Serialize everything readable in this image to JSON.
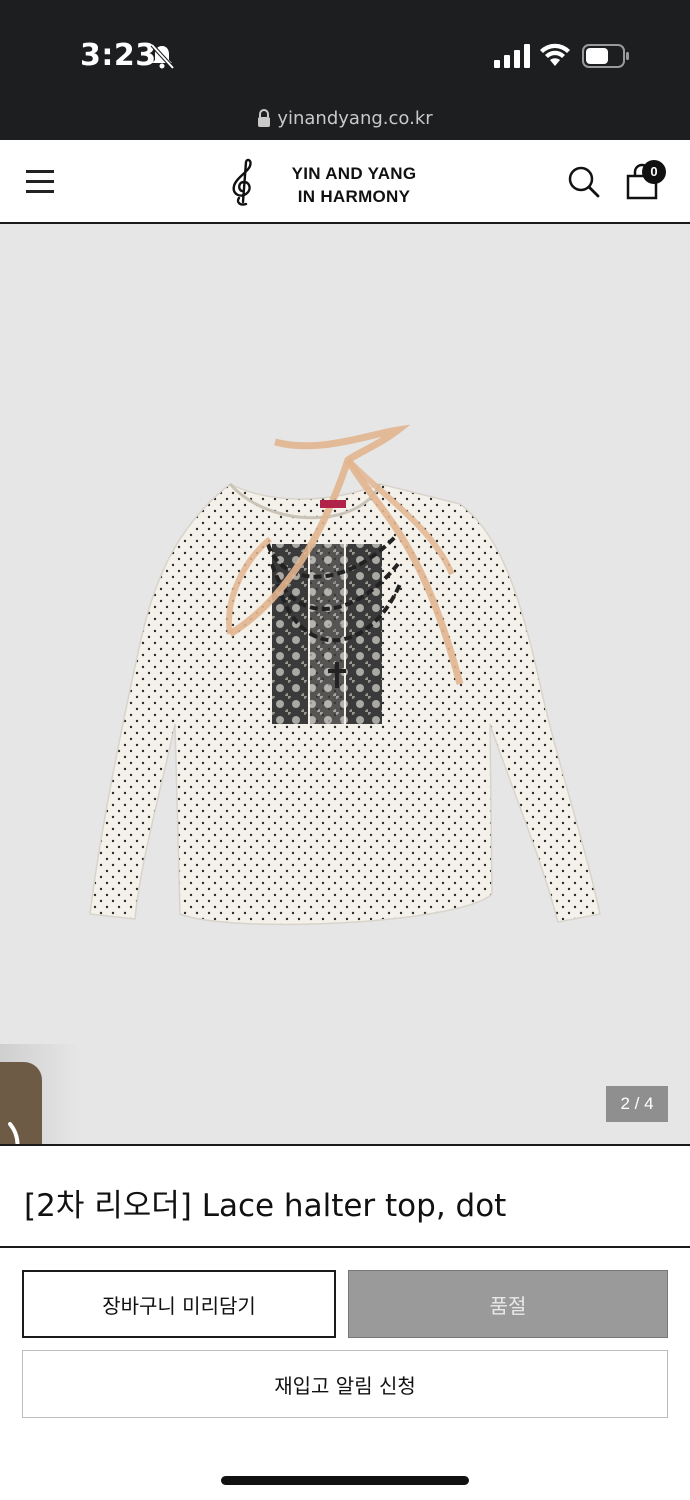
{
  "status_bar": {
    "time": "3:23"
  },
  "browser": {
    "url": "yinandyang.co.kr"
  },
  "header": {
    "logo_line1": "YIN AND YANG",
    "logo_line2": "IN HARMONY",
    "cart_count": "0",
    "icons": [
      "menu-icon",
      "treble-clef-logo",
      "search-icon",
      "shopping-bag-icon"
    ]
  },
  "gallery": {
    "counter": "2 / 4",
    "current_image": 2,
    "total_images": 4
  },
  "product": {
    "title": "[2차 리오더] Lace halter top, dot"
  },
  "actions": {
    "add_to_cart": "장바구니 미리담기",
    "sold_out": "품절",
    "restock_alert": "재입고 알림 신청"
  },
  "colors": {
    "side_tab": "#6e5b46",
    "sold_out_bg": "#9a9a9a",
    "gallery_bg": "#e6e6e6"
  }
}
